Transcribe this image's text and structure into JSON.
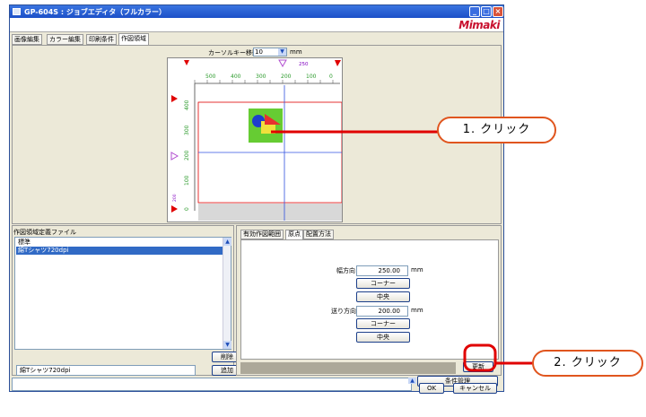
{
  "window": {
    "title": "GP-604S : ジョブエディタ（フルカラー）",
    "brand": "Mimaki",
    "minimize": "_",
    "maximize": "□",
    "close": "×"
  },
  "tabs": [
    "画像編集",
    "カラー編集",
    "印刷条件",
    "作図領域"
  ],
  "cursor": {
    "label": "カーソルキー移動量",
    "value": "10",
    "unit": "mm"
  },
  "ruler": {
    "origin_readout": "250",
    "x_ticks": [
      "500",
      "400",
      "300",
      "200",
      "100",
      "0"
    ],
    "y_ticks": [
      "400",
      "300",
      "200",
      "100",
      "0"
    ],
    "y_small": "200"
  },
  "file_panel": {
    "title": "作図領域定義ファイル",
    "items": [
      "標準",
      "綿Tシャツ720dpi"
    ],
    "selected": 1,
    "delete": "削除",
    "name_value": "綿Tシャツ720dpi",
    "add": "追加"
  },
  "right_tabs": [
    "有効作図範囲",
    "原点",
    "配置方法"
  ],
  "origin": {
    "width_label": "幅方向",
    "width_value": "250.00",
    "feed_label": "送り方向",
    "feed_value": "200.00",
    "unit": "mm",
    "corner": "コーナー",
    "center": "中央"
  },
  "update_button": "更新",
  "bottom": {
    "condition_mgmt": "条件管理",
    "ok": "OK",
    "cancel": "キャンセル"
  },
  "callouts": {
    "one": "1. クリック",
    "two": "2. クリック"
  },
  "colors": {
    "accent": "#e00000",
    "callout": "#e0551e",
    "highlight": "#316ac5"
  }
}
